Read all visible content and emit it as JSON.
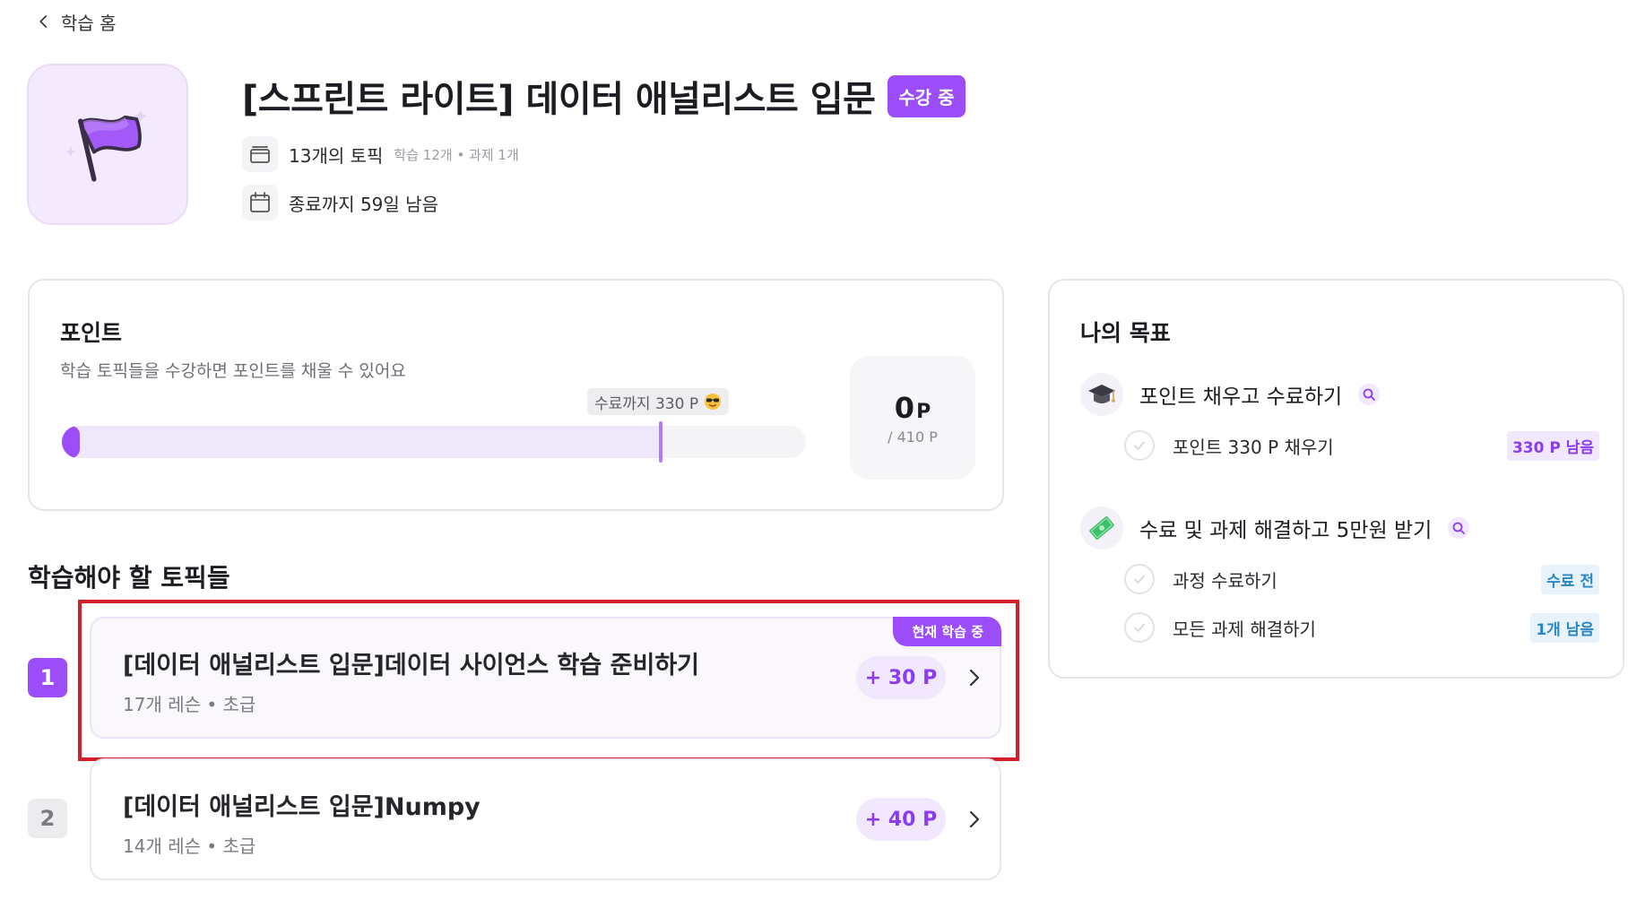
{
  "nav": {
    "back_label": "학습 홈"
  },
  "course": {
    "title": "[스프린트 라이트] 데이터 애널리스트 입문",
    "status_badge": "수강 중",
    "topic_count": "13개의 토픽",
    "topic_breakdown": "학습 12개 • 과제 1개",
    "remaining": "종료까지 59일 남음",
    "icon": "purple-flag-icon"
  },
  "points_card": {
    "title": "포인트",
    "description": "학습 토픽들을 수강하면 포인트를 채울 수 있어요",
    "goal_tag": "수료까지 330 P",
    "goal_tag_emoji": "sunglasses-emoji",
    "current_value": "0",
    "current_unit": "P",
    "total": "/ 410 P",
    "progress_fraction": 0.0,
    "goal_fraction": 0.805
  },
  "goals_card": {
    "title": "나의 목표",
    "goals": [
      {
        "label": "포인트 채우고 수료하기",
        "icon": "graduation-cap-icon",
        "items": [
          {
            "label": "포인트 330 P 채우기",
            "status": "330 P 남음",
            "status_color": "purple"
          }
        ]
      },
      {
        "label": "수료 및 과제 해결하고 5만원 받기",
        "icon": "money-icon",
        "items": [
          {
            "label": "과정 수료하기",
            "status": "수료 전",
            "status_color": "blue"
          },
          {
            "label": "모든 과제 해결하기",
            "status": "1개 남음",
            "status_color": "blue"
          }
        ]
      }
    ]
  },
  "topics": {
    "section_title": "학습해야 할 토픽들",
    "items": [
      {
        "number": "1",
        "title": "[데이터 애널리스트 입문]데이터 사이언스 학습 준비하기",
        "meta": "17개 레슨 • 초급",
        "points": "+ 30 P",
        "current_tag": "현재 학습 중"
      },
      {
        "number": "2",
        "title": "[데이터 애널리스트 입문]Numpy",
        "meta": "14개 레슨 • 초급",
        "points": "+ 40 P"
      }
    ]
  },
  "colors": {
    "accent": "#9b4dfa",
    "accent_light": "#f1e8fd",
    "status_blue": "#2b87c6",
    "highlight_red": "#d41f28"
  }
}
